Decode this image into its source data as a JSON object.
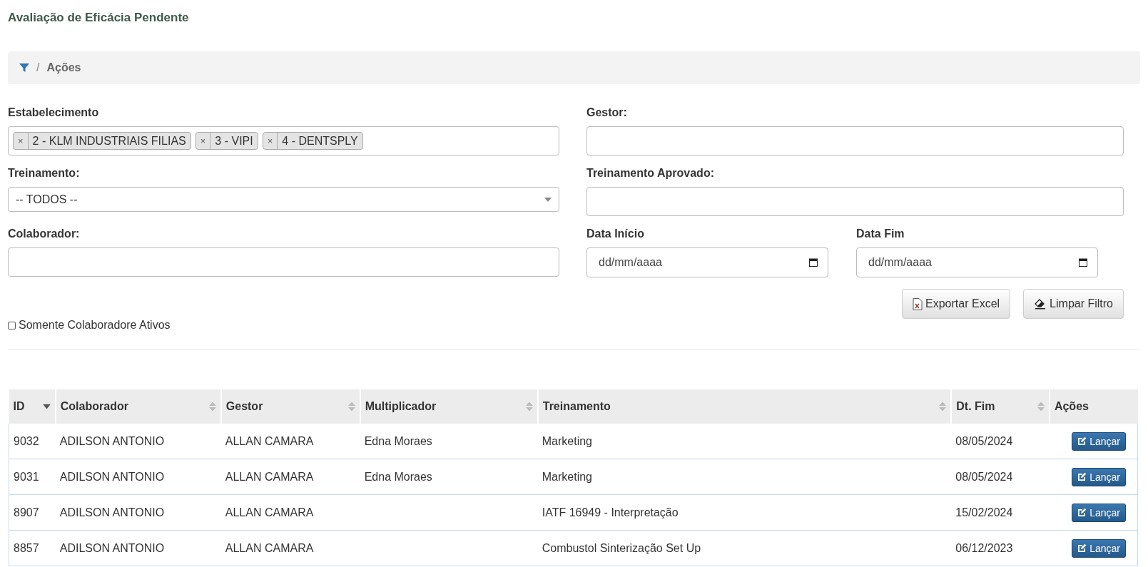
{
  "page_title": "Avaliação de Eficácia Pendente",
  "breadcrumb": {
    "separator": "/",
    "current": "Ações"
  },
  "filters": {
    "estabelecimento": {
      "label": "Estabelecimento",
      "tags": [
        {
          "remove": "×",
          "label": "2 - KLM INDUSTRIAIS FILIAS"
        },
        {
          "remove": "×",
          "label": "3 - VIPI"
        },
        {
          "remove": "×",
          "label": "4 - DENTSPLY"
        }
      ]
    },
    "gestor": {
      "label": "Gestor:"
    },
    "treinamento": {
      "label": "Treinamento:",
      "value": "-- TODOS --"
    },
    "treinamento_aprovado": {
      "label": "Treinamento Aprovado:"
    },
    "colaborador": {
      "label": "Colaborador:"
    },
    "data_inicio": {
      "label": "Data Início",
      "placeholder": "dd/mm/aaaa"
    },
    "data_fim": {
      "label": "Data Fim",
      "placeholder": "dd/mm/aaaa"
    },
    "buttons": [
      {
        "kind": "excel",
        "label": "Exportar Excel"
      },
      {
        "kind": "eraser",
        "label": "Limpar Filtro"
      }
    ],
    "somente_ativos": {
      "label": "Somente Colaboradore Ativos",
      "checked": false
    }
  },
  "table": {
    "columns": [
      {
        "label": "ID",
        "sortable": true,
        "sorted_descending": true
      },
      {
        "label": "Colaborador",
        "sortable": true,
        "sorted_descending": false
      },
      {
        "label": "Gestor",
        "sortable": true,
        "sorted_descending": false
      },
      {
        "label": "Multiplicador",
        "sortable": true,
        "sorted_descending": false
      },
      {
        "label": "Treinamento",
        "sortable": true,
        "sorted_descending": false
      },
      {
        "label": "Dt. Fim",
        "sortable": true,
        "sorted_descending": false
      },
      {
        "label": "Ações",
        "sortable": false
      }
    ],
    "rows": [
      {
        "cells": [
          "9032",
          "ADILSON ANTONIO",
          "ALLAN CAMARA",
          "Edna Moraes",
          "Marketing",
          "08/05/2024"
        ],
        "action": "Lançar"
      },
      {
        "cells": [
          "9031",
          "ADILSON ANTONIO",
          "ALLAN CAMARA",
          "Edna Moraes",
          "Marketing",
          "08/05/2024"
        ],
        "action": "Lançar"
      },
      {
        "cells": [
          "8907",
          "ADILSON ANTONIO",
          "ALLAN CAMARA",
          "",
          "IATF 16949 - Interpretação",
          "15/02/2024"
        ],
        "action": "Lançar"
      },
      {
        "cells": [
          "8857",
          "ADILSON ANTONIO",
          "ALLAN CAMARA",
          "",
          "Combustol Sinterização Set Up",
          "06/12/2023"
        ],
        "action": "Lançar"
      }
    ]
  }
}
